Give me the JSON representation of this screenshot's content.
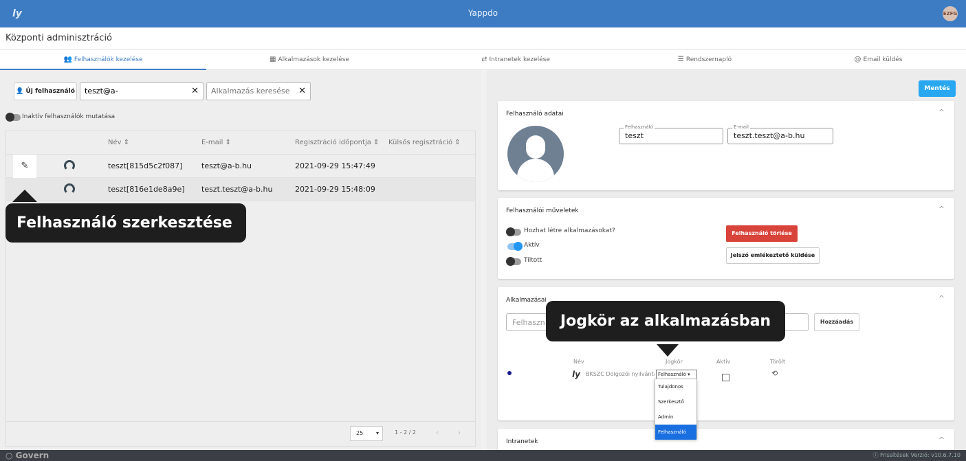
{
  "topbar": {
    "logo": "ly",
    "title": "Yappdo",
    "avatar": "EZFG"
  },
  "subheader": {
    "title": "Központi adminisztráció"
  },
  "tabs": [
    {
      "icon": "👥",
      "label": "Felhasználók kezelése"
    },
    {
      "icon": "▦",
      "label": "Alkalmazások kezelése"
    },
    {
      "icon": "⇄",
      "label": "Intranetek kezelése"
    },
    {
      "icon": "☰",
      "label": "Rendszernapló"
    },
    {
      "icon": "@",
      "label": "Email küldés"
    }
  ],
  "left": {
    "new_user_button": "Új felhasználó",
    "search_value": "teszt@a-",
    "app_search_placeholder": "Alkalmazás keresése",
    "inactive_toggle_label": "Inaktív felhasználók mutatása",
    "columns": [
      "Név ⇕",
      "E-mail ⇕",
      "Regisztráció időpontja ⇕",
      "Külsős regisztráció ⇕"
    ],
    "rows": [
      {
        "name": "teszt[815d5c2f087]",
        "email": "teszt@a-b.hu",
        "date": "2021-09-29 15:47:49"
      },
      {
        "name": "teszt[816e1de8a9e]",
        "email": "teszt.teszt@a-b.hu",
        "date": "2021-09-29 15:48:09"
      }
    ],
    "page_size": "25",
    "page_range": "1 - 2 / 2",
    "page_arrows": "‹ ›"
  },
  "callouts": {
    "edit_user": "Felhasználó szerkesztése",
    "app_role": "Jogkör az alkalmazásban"
  },
  "right": {
    "save_button": "Mentés",
    "user_data": {
      "title": "Felhasználó adatai",
      "username_legend": "Felhasználó",
      "username_value": "teszt",
      "email_legend": "E-mail",
      "email_value": "teszt.teszt@a-b.hu"
    },
    "user_ops": {
      "title": "Felhasználói műveletek",
      "can_create_apps": "Hozhat létre alkalmazásokat?",
      "active": "Aktív",
      "banned": "Tiltott",
      "delete_button": "Felhasználó törlése",
      "password_button": "Jelszó emlékeztető küldése"
    },
    "apps": {
      "title": "Alkalmazásai",
      "field_placeholder": "Felhaszn",
      "add_button": "Hozzáadás",
      "col_name": "Név",
      "col_role": "Jogkör",
      "col_active": "Aktív",
      "col_deleted": "Törölt",
      "app_logo": "ly",
      "app_name": "BKSZC Dolgozói nyilvántartás",
      "selected_role": "Felhasználó ▾",
      "role_options": [
        "Tulajdonos",
        "Szerkesztő",
        "Admin",
        "Felhasználó"
      ]
    },
    "intranets": {
      "title": "Intranetek"
    }
  },
  "footer": {
    "brand": "○ Govern",
    "right": "ⓘ Frissítések   Verzió: v10.6.7.10"
  }
}
